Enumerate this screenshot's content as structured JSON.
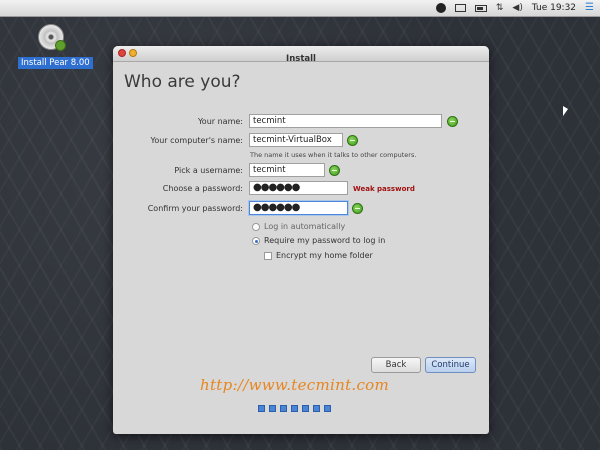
{
  "menubar": {
    "clock": "Tue 19:32"
  },
  "desktop": {
    "icon_label": "Install Pear 8.00"
  },
  "window": {
    "title": "Install",
    "heading": "Who are you?"
  },
  "form": {
    "your_name": {
      "label": "Your name:",
      "value": "tecmint"
    },
    "computer_name": {
      "label": "Your computer's name:",
      "value": "tecmint-VirtualBox",
      "hint": "The name it uses when it talks to other computers."
    },
    "username": {
      "label": "Pick a username:",
      "value": "tecmint"
    },
    "password": {
      "label": "Choose a password:",
      "value": "●●●●●●",
      "strength": "Weak password"
    },
    "confirm_password": {
      "label": "Confirm your password:",
      "value": "●●●●●●"
    }
  },
  "options": {
    "login_auto": {
      "label": "Log in automatically",
      "selected": false
    },
    "require_password": {
      "label": "Require my password to log in",
      "selected": true
    },
    "encrypt_home": {
      "label": "Encrypt my home folder",
      "checked": false
    }
  },
  "buttons": {
    "back": "Back",
    "continue": "Continue"
  },
  "watermark": "http://www.tecmint.com",
  "progress": {
    "total_steps": 7
  },
  "colors": {
    "accent": "#4a84d6",
    "weak_password": "#a01010",
    "valid": "#3f9a1e",
    "watermark": "#e8851f"
  }
}
